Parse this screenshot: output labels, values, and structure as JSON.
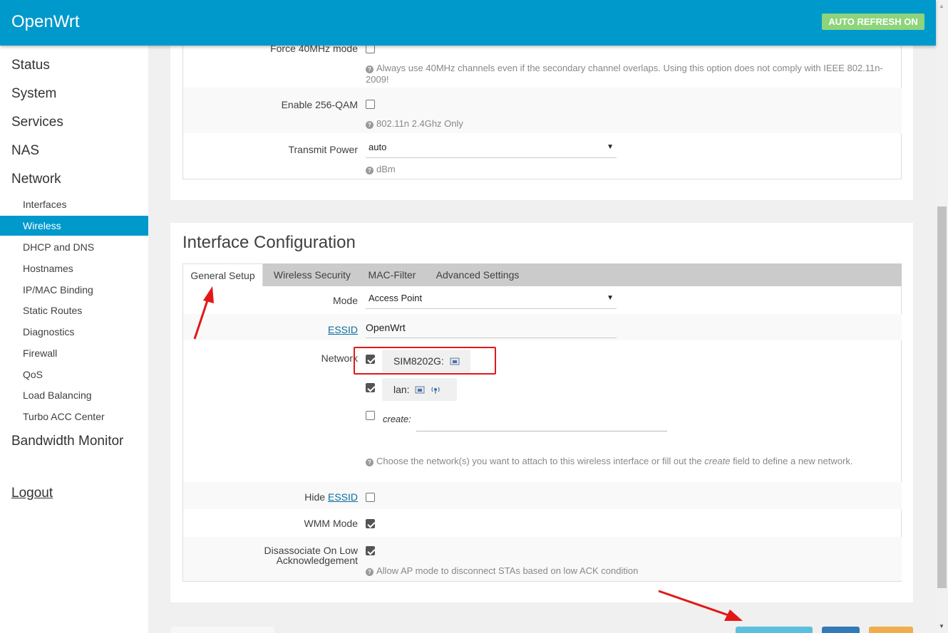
{
  "header": {
    "brand": "OpenWrt",
    "auto_refresh": "AUTO REFRESH ON",
    "colors": {
      "bar": "#0099cc",
      "auto_refresh_bg": "#8ed47a"
    }
  },
  "sidebar": {
    "top_items": [
      "Status",
      "System",
      "Services",
      "NAS",
      "Network"
    ],
    "network_items": [
      "Interfaces",
      "Wireless",
      "DHCP and DNS",
      "Hostnames",
      "IP/MAC Binding",
      "Static Routes",
      "Diagnostics",
      "Firewall",
      "QoS",
      "Load Balancing",
      "Turbo ACC Center"
    ],
    "active_item": "Wireless",
    "bandwidth_monitor": "Bandwidth Monitor",
    "logout": "Logout"
  },
  "device_config": {
    "force40_label": "Force 40MHz mode",
    "force40_checked": false,
    "force40_help": "Always use 40MHz channels even if the secondary channel overlaps. Using this option does not comply with IEEE 802.11n-2009!",
    "qam_label": "Enable 256-QAM",
    "qam_checked": false,
    "qam_help": "802.11n 2.4Ghz Only",
    "tx_label": "Transmit Power",
    "tx_value": "auto",
    "tx_help": "dBm"
  },
  "iface": {
    "title": "Interface Configuration",
    "tabs": [
      "General Setup",
      "Wireless Security",
      "MAC-Filter",
      "Advanced Settings"
    ],
    "active_tab": "General Setup",
    "mode_label": "Mode",
    "mode_value": "Access Point",
    "essid_label": "ESSID",
    "essid_value": "OpenWrt",
    "network_label": "Network",
    "networks": [
      {
        "name": "SIM8202G:",
        "checked": true,
        "icons": [
          "ethernet-port-icon"
        ]
      },
      {
        "name": "lan:",
        "checked": true,
        "icons": [
          "ethernet-port-icon",
          "wifi-antenna-icon"
        ]
      }
    ],
    "create_label": "create:",
    "create_checked": false,
    "network_help_a": "Choose the network(s) you want to attach to this wireless interface or fill out the",
    "network_help_em": "create",
    "network_help_b": "field to define a new network.",
    "hide_prefix": "Hide",
    "hide_essid": "ESSID",
    "hide_checked": false,
    "wmm_label": "WMM Mode",
    "wmm_checked": true,
    "disassoc_label_1": "Disassociate On Low",
    "disassoc_label_2": "Acknowledgement",
    "disassoc_checked": true,
    "disassoc_help": "Allow AP mode to disconnect STAs based on low ACK condition"
  },
  "annotations": {
    "highlight_color": "#e21818"
  },
  "footer_buttons": {
    "colors": [
      "#5bc0de",
      "#337ab7",
      "#f0ad4e"
    ]
  }
}
